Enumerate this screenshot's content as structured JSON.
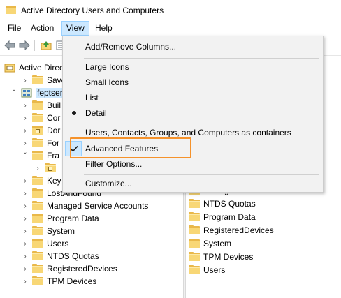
{
  "window": {
    "title": "Active Directory Users and Computers",
    "app_icon": "ad-console-icon"
  },
  "menubar": {
    "items": [
      "File",
      "Action",
      "View",
      "Help"
    ],
    "active": "View"
  },
  "toolbar": {
    "buttons": [
      "back-arrow-icon",
      "forward-arrow-icon",
      "up-folder-icon",
      "console-tree-icon"
    ]
  },
  "tree": {
    "rows": [
      {
        "label": "Active Directo",
        "icon": "ad-root-icon",
        "expander": ""
      },
      {
        "label": "Saved Q",
        "icon": "folder-icon",
        "expander": ">"
      },
      {
        "label": "feptserv",
        "icon": "domain-icon",
        "expander": "v"
      },
      {
        "label": "Buil",
        "icon": "folder-icon",
        "expander": ">"
      },
      {
        "label": "Cor",
        "icon": "folder-icon",
        "expander": ">"
      },
      {
        "label": "Dor",
        "icon": "ou-folder-icon",
        "expander": ">"
      },
      {
        "label": "For",
        "icon": "folder-icon",
        "expander": ">"
      },
      {
        "label": "Fra",
        "icon": "folder-icon",
        "expander": "v"
      },
      {
        "label": "",
        "icon": "ou-folder-icon",
        "expander": ">"
      },
      {
        "label": "Key",
        "icon": "folder-icon",
        "expander": ">"
      },
      {
        "label": "LostAndFound",
        "icon": "folder-icon",
        "expander": ">"
      },
      {
        "label": "Managed Service Accounts",
        "icon": "folder-icon",
        "expander": ">"
      },
      {
        "label": "Program Data",
        "icon": "folder-icon",
        "expander": ">"
      },
      {
        "label": "System",
        "icon": "folder-icon",
        "expander": ">"
      },
      {
        "label": "Users",
        "icon": "folder-icon",
        "expander": ">"
      },
      {
        "label": "NTDS Quotas",
        "icon": "folder-icon",
        "expander": ">"
      },
      {
        "label": "RegisteredDevices",
        "icon": "folder-icon",
        "expander": ">"
      },
      {
        "label": "TPM Devices",
        "icon": "folder-icon",
        "expander": ">"
      }
    ]
  },
  "list": {
    "rows": [
      {
        "label": "Managed Service Accounts"
      },
      {
        "label": "NTDS Quotas"
      },
      {
        "label": "Program Data"
      },
      {
        "label": "RegisteredDevices"
      },
      {
        "label": "System"
      },
      {
        "label": "TPM Devices"
      },
      {
        "label": "Users"
      }
    ]
  },
  "view_menu": {
    "add_remove_columns": "Add/Remove Columns...",
    "large_icons": "Large Icons",
    "small_icons": "Small Icons",
    "list": "List",
    "detail": "Detail",
    "containers": "Users, Contacts, Groups, and Computers as containers",
    "advanced_features": "Advanced Features",
    "filter_options": "Filter Options...",
    "customize": "Customize...",
    "selected_view": "Detail",
    "advanced_features_checked": true,
    "highlight_color": "#f5922b"
  }
}
